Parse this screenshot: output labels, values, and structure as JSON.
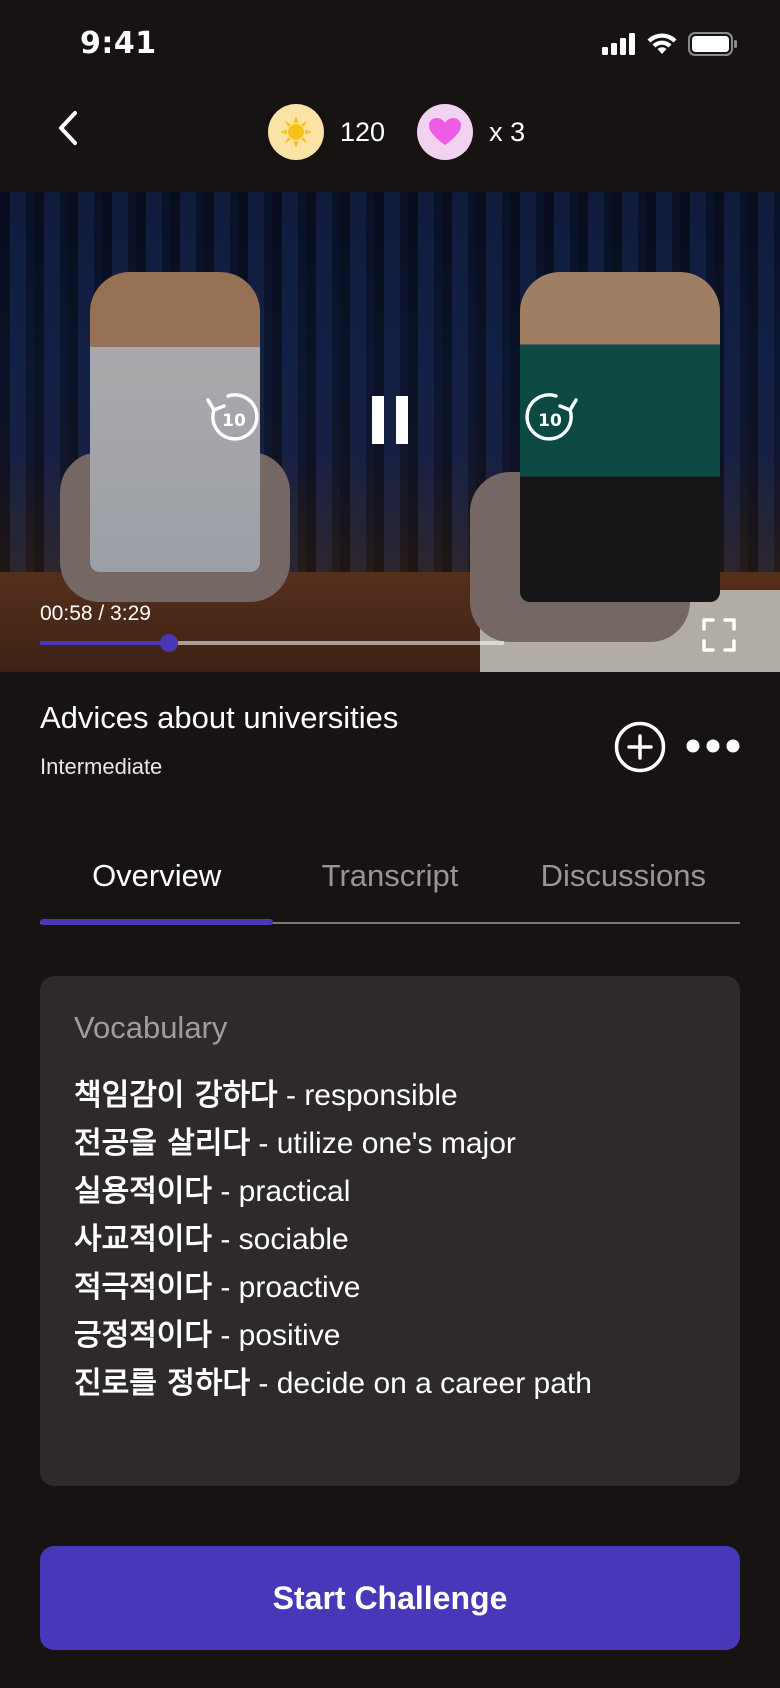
{
  "status_bar": {
    "time": "9:41"
  },
  "header": {
    "points": "120",
    "lives": "x 3"
  },
  "player": {
    "time_display": "00:58 / 3:29",
    "progress_fraction": 0.277,
    "rewind_seconds": "10",
    "forward_seconds": "10"
  },
  "lesson": {
    "title": "Advices about universities",
    "level": "Intermediate"
  },
  "tabs": [
    {
      "label": "Overview",
      "active": true
    },
    {
      "label": "Transcript",
      "active": false
    },
    {
      "label": "Discussions",
      "active": false
    }
  ],
  "vocabulary": {
    "heading": "Vocabulary",
    "items": [
      {
        "term": "책임감이 강하다",
        "meaning": " - responsible"
      },
      {
        "term": "전공을 살리다",
        "meaning": " - utilize one's major"
      },
      {
        "term": "실용적이다",
        "meaning": " - practical"
      },
      {
        "term": "사교적이다",
        "meaning": " - sociable"
      },
      {
        "term": "적극적이다",
        "meaning": " - proactive"
      },
      {
        "term": "긍정적이다",
        "meaning": " - positive"
      },
      {
        "term": "진로를 정하다",
        "meaning": " - decide on a career path"
      }
    ]
  },
  "cta": {
    "label": "Start Challenge"
  },
  "colors": {
    "background": "#171313",
    "accent": "#4937b9",
    "card": "#2e2a2a",
    "muted_text": "#9a9494"
  },
  "icons": {
    "back": "chevron-left-icon",
    "points": "sun-icon",
    "lives": "heart-icon",
    "rewind": "rewind-10-icon",
    "pause": "pause-icon",
    "forward": "forward-10-icon",
    "fullscreen": "fullscreen-icon",
    "add": "plus-circle-icon",
    "more": "more-dots-icon"
  }
}
